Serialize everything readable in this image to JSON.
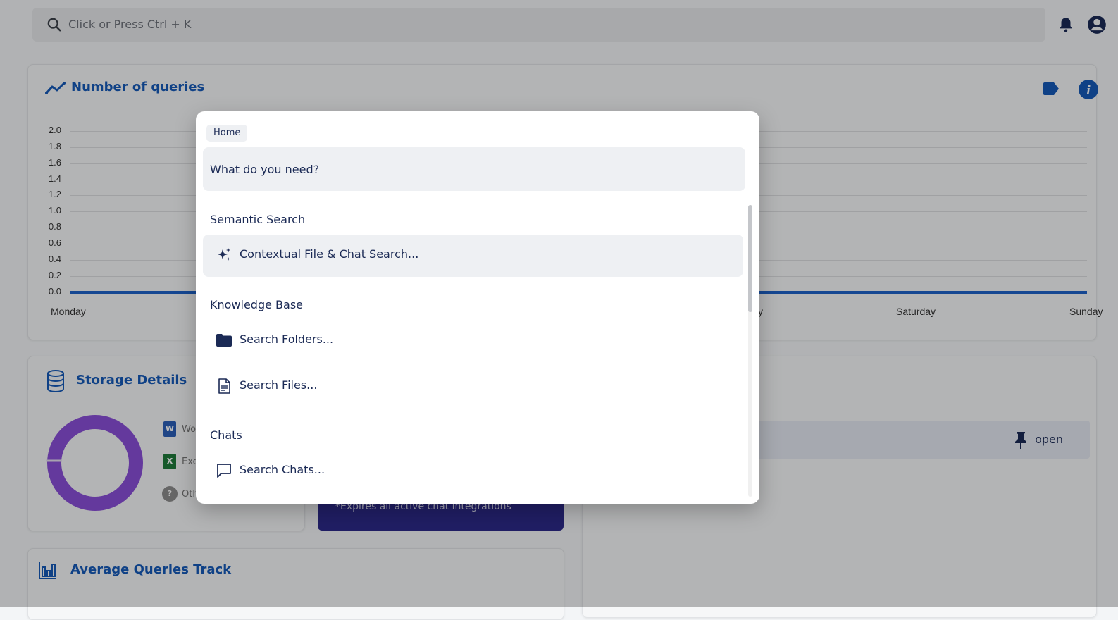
{
  "topbar": {
    "search_placeholder": "Click or Press Ctrl + K"
  },
  "queries_card": {
    "title": "Number of queries",
    "y_ticks": [
      "2.0",
      "1.8",
      "1.6",
      "1.4",
      "1.2",
      "1.0",
      "0.8",
      "0.6",
      "0.4",
      "0.2",
      "0.0"
    ],
    "x_visible_labels": [
      "Monday",
      "y",
      "Saturday",
      "Sunday"
    ]
  },
  "storage_card": {
    "title": "Storage Details",
    "legend": [
      "Wo",
      "Exc",
      "Oth"
    ],
    "badges": [
      "W",
      "X",
      "?"
    ]
  },
  "purple_action": {
    "note": "*Expires all active chat integrations"
  },
  "pinned_row": {
    "open_label": "open"
  },
  "avg_card": {
    "title": "Average Queries Track"
  },
  "command_palette": {
    "breadcrumb": "Home",
    "input_placeholder": "What do you need?",
    "groups": [
      {
        "heading": "Semantic Search",
        "items": [
          {
            "label": "Contextual File & Chat Search...",
            "icon": "sparkles-icon"
          }
        ]
      },
      {
        "heading": "Knowledge Base",
        "items": [
          {
            "label": "Search Folders...",
            "icon": "folder-icon"
          },
          {
            "label": "Search Files...",
            "icon": "file-icon"
          }
        ]
      },
      {
        "heading": "Chats",
        "items": [
          {
            "label": "Search Chats...",
            "icon": "chat-icon"
          }
        ]
      }
    ]
  },
  "colors": {
    "accent": "#1559b8",
    "navy": "#1b2a55",
    "donut": "#7b3fd0",
    "purple_button": "#2c2a8a"
  }
}
